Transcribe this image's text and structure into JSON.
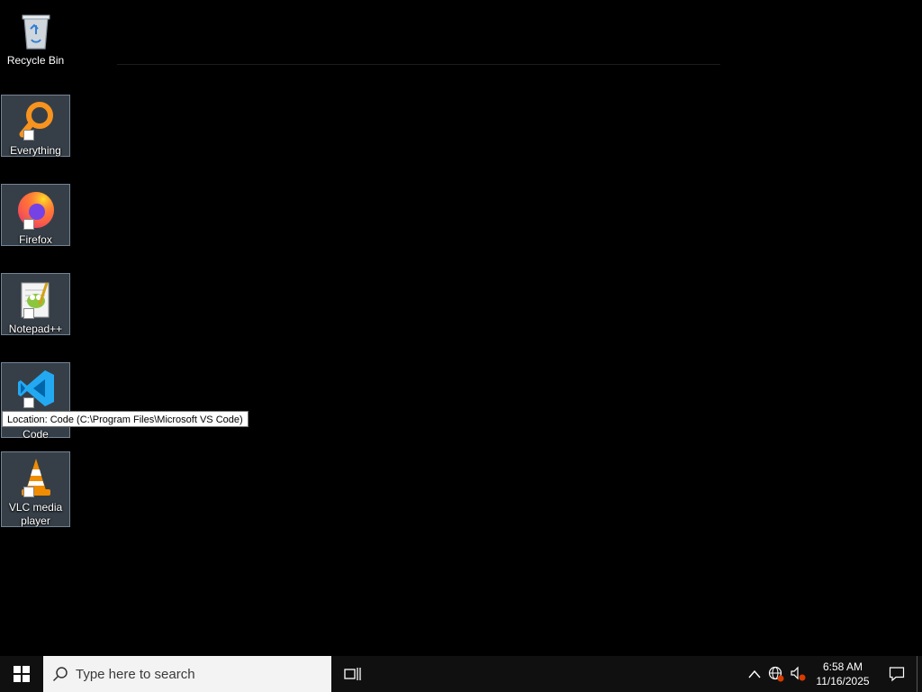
{
  "desktop": {
    "icons": [
      {
        "label": "Recycle Bin",
        "icon": "recycle-bin-icon"
      },
      {
        "label": "Everything",
        "icon": "everything-search-icon"
      },
      {
        "label": "Firefox",
        "icon": "firefox-icon"
      },
      {
        "label": "Notepad++",
        "icon": "notepad-plus-plus-icon"
      },
      {
        "label": "Code",
        "icon": "vscode-icon"
      },
      {
        "label": "VLC media player",
        "icon": "vlc-icon"
      }
    ],
    "tooltip": "Location: Code (C:\\Program Files\\Microsoft VS Code)"
  },
  "taskbar": {
    "search_placeholder": "Type here to search",
    "clock": {
      "time": "6:58 AM",
      "date": "11/16/2025"
    }
  },
  "colors": {
    "desktop_bg": "#000000",
    "taskbar_bg": "#101010",
    "vscode_blue": "#23a9f2",
    "everything_orange": "#f7931e",
    "vlc_orange": "#f08c00"
  }
}
